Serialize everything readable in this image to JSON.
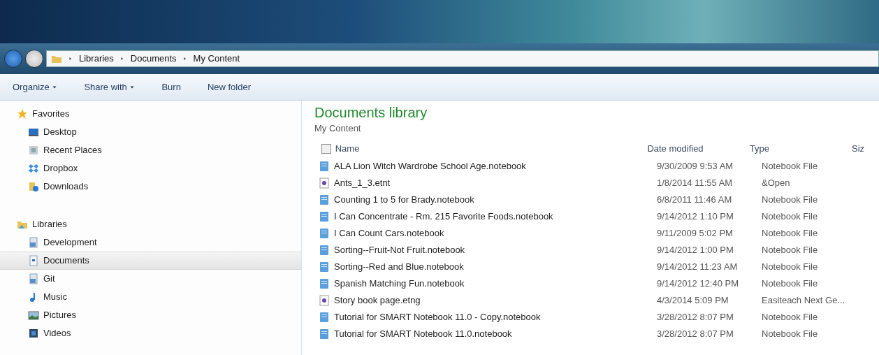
{
  "address_bar": {
    "breadcrumbs": [
      "Libraries",
      "Documents",
      "My Content"
    ]
  },
  "toolbar": [
    {
      "label": "Organize",
      "dropdown": true
    },
    {
      "label": "Share with",
      "dropdown": true
    },
    {
      "label": "Burn",
      "dropdown": false
    },
    {
      "label": "New folder",
      "dropdown": false
    }
  ],
  "sidebar": {
    "groups": [
      {
        "label": "Favorites",
        "kind": "star",
        "children": [
          {
            "label": "Desktop",
            "kind": "desktop",
            "selected": false
          },
          {
            "label": "Recent Places",
            "kind": "recent",
            "selected": false
          },
          {
            "label": "Dropbox",
            "kind": "dropbox",
            "selected": false
          },
          {
            "label": "Downloads",
            "kind": "downloads",
            "selected": false
          }
        ]
      },
      {
        "label": "Libraries",
        "kind": "libraries",
        "children": [
          {
            "label": "Development",
            "kind": "library",
            "selected": false
          },
          {
            "label": "Documents",
            "kind": "documents",
            "selected": true
          },
          {
            "label": "Git",
            "kind": "library",
            "selected": false
          },
          {
            "label": "Music",
            "kind": "music",
            "selected": false
          },
          {
            "label": "Pictures",
            "kind": "pictures",
            "selected": false
          },
          {
            "label": "Videos",
            "kind": "videos",
            "selected": false
          }
        ]
      }
    ]
  },
  "library": {
    "title": "Documents library",
    "subtitle": "My Content"
  },
  "table": {
    "select_all_checked": false,
    "columns": [
      "Name",
      "Date modified",
      "Type",
      "Siz"
    ],
    "rows": [
      {
        "kind": "notebook",
        "name": "ALA Lion Witch Wardrobe School Age.notebook",
        "date": "9/30/2009 9:53 AM",
        "type": "Notebook File"
      },
      {
        "kind": "disc",
        "name": "Ants_1_3.etnt",
        "date": "1/8/2014 11:55 AM",
        "type": "&Open"
      },
      {
        "kind": "notebook",
        "name": "Counting 1 to 5 for Brady.notebook",
        "date": "6/8/2011 11:46 AM",
        "type": "Notebook File"
      },
      {
        "kind": "notebook",
        "name": "I Can Concentrate - Rm. 215 Favorite Foods.notebook",
        "date": "9/14/2012 1:10 PM",
        "type": "Notebook File"
      },
      {
        "kind": "notebook",
        "name": "I Can Count Cars.notebook",
        "date": "9/11/2009 5:02 PM",
        "type": "Notebook File"
      },
      {
        "kind": "notebook",
        "name": "Sorting--Fruit-Not Fruit.notebook",
        "date": "9/14/2012 1:00 PM",
        "type": "Notebook File"
      },
      {
        "kind": "notebook",
        "name": "Sorting--Red and Blue.notebook",
        "date": "9/14/2012 11:23 AM",
        "type": "Notebook File"
      },
      {
        "kind": "notebook",
        "name": "Spanish Matching Fun.notebook",
        "date": "9/14/2012 12:40 PM",
        "type": "Notebook File"
      },
      {
        "kind": "disc",
        "name": "Story book page.etng",
        "date": "4/3/2014 5:09 PM",
        "type": "Easiteach Next Ge..."
      },
      {
        "kind": "notebook",
        "name": "Tutorial for SMART Notebook 11.0 - Copy.notebook",
        "date": "3/28/2012 8:07 PM",
        "type": "Notebook File"
      },
      {
        "kind": "notebook",
        "name": "Tutorial for SMART Notebook 11.0.notebook",
        "date": "3/28/2012 8:07 PM",
        "type": "Notebook File"
      }
    ]
  }
}
